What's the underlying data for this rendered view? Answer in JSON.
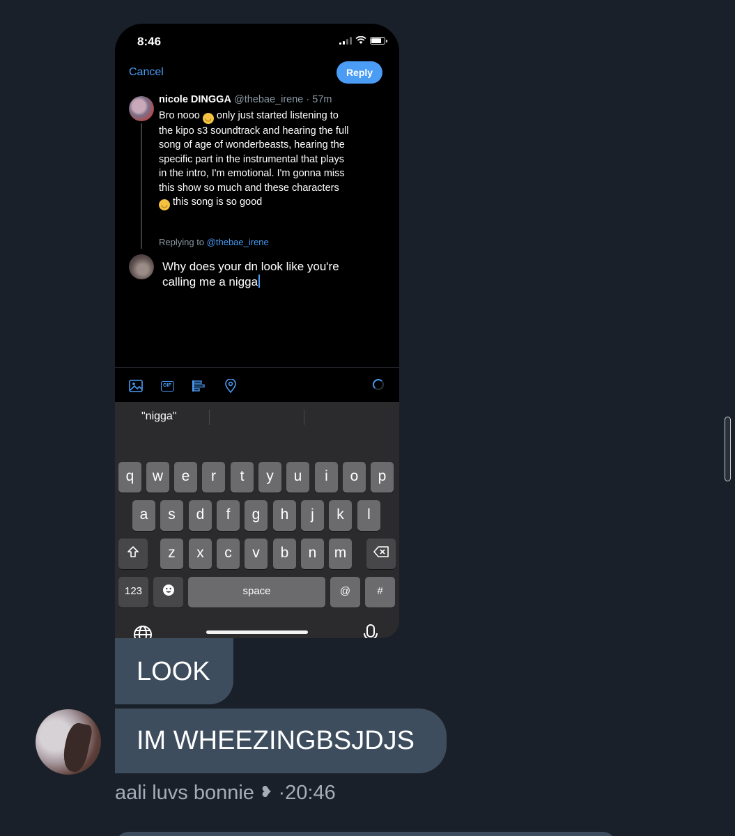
{
  "phone": {
    "status": {
      "time": "8:46"
    },
    "nav": {
      "cancel": "Cancel",
      "reply": "Reply"
    },
    "tweet": {
      "name": "nicole DINGGA",
      "handle": "@thebae_irene",
      "age": "57m",
      "line1a": "Bro nooo",
      "line1b": "only just started listening to",
      "line2": "the kipo s3 soundtrack and hearing the full",
      "line3": "song of age of wonderbeasts, hearing the",
      "line4": "specific part in the instrumental that plays",
      "line5": "in the intro, I'm emotional. I'm gonna miss",
      "line6": "this show so much and these characters",
      "line7": "this song is so good"
    },
    "replying_to": {
      "prefix": "Replying to",
      "handle": "@thebae_irene"
    },
    "compose": {
      "line1": "Why does your dn look like you're",
      "line2": "calling me a nigga"
    },
    "keyboard": {
      "suggestion": "\"nigga\"",
      "row1": [
        "q",
        "w",
        "e",
        "r",
        "t",
        "y",
        "u",
        "i",
        "o",
        "p"
      ],
      "row2": [
        "a",
        "s",
        "d",
        "f",
        "g",
        "h",
        "j",
        "k",
        "l"
      ],
      "row3": [
        "z",
        "x",
        "c",
        "v",
        "b",
        "n",
        "m"
      ],
      "numbers": "123",
      "space": "space",
      "at": "@",
      "hash": "#"
    }
  },
  "chat": {
    "messages": [
      "LOOK",
      "IM WHEEZINGBSJDJS"
    ],
    "sender": "aali luvs bonnie",
    "separator": "·",
    "time": "20:46"
  },
  "colors": {
    "accent": "#4a9cf5",
    "bubble": "#3e4d5e",
    "background": "#192029"
  }
}
